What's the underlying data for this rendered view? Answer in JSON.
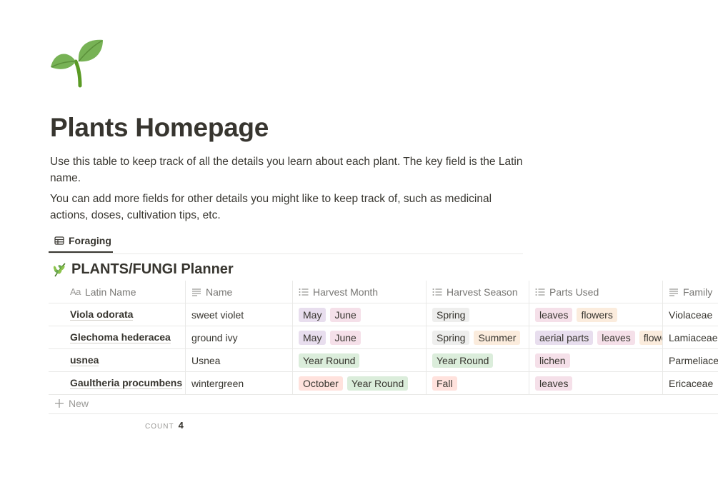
{
  "page": {
    "title": "Plants Homepage",
    "description": [
      "Use this table to keep track of all the details you learn about each plant. The key field is the Latin name.",
      "You can add more fields for other details you might like to keep track of, such as medicinal actions, doses, cultivation tips, etc."
    ],
    "icon": "seedling-icon"
  },
  "views": {
    "active_tab": "Foraging"
  },
  "database": {
    "title": "PLANTS/FUNGI Planner",
    "icon": "herb-icon",
    "columns": [
      "Latin Name",
      "Name",
      "Harvest Month",
      "Harvest Season",
      "Parts Used",
      "Family"
    ],
    "column_icons": [
      "text-aa-icon",
      "text-lines-icon",
      "list-icon",
      "list-icon",
      "list-icon",
      "text-lines-icon"
    ],
    "rows": [
      {
        "latin": "Viola odorata",
        "name": "sweet violet",
        "months": [
          {
            "label": "May",
            "color": "#e8deee"
          },
          {
            "label": "June",
            "color": "#f5e0e9"
          }
        ],
        "seasons": [
          {
            "label": "Spring",
            "color": "#eeeeed"
          }
        ],
        "parts": [
          {
            "label": "leaves",
            "color": "#f5e0e9"
          },
          {
            "label": "flowers",
            "color": "#fbecdd"
          }
        ],
        "family": "Violaceae"
      },
      {
        "latin": "Glechoma hederacea",
        "name": "ground ivy",
        "months": [
          {
            "label": "May",
            "color": "#e8deee"
          },
          {
            "label": "June",
            "color": "#f5e0e9"
          }
        ],
        "seasons": [
          {
            "label": "Spring",
            "color": "#eeeeed"
          },
          {
            "label": "Summer",
            "color": "#fbecdd"
          }
        ],
        "parts": [
          {
            "label": "aerial parts",
            "color": "#e8deee"
          },
          {
            "label": "leaves",
            "color": "#f5e0e9"
          },
          {
            "label": "flowers",
            "color": "#fbecdd"
          }
        ],
        "family": "Lamiaceae"
      },
      {
        "latin": "usnea",
        "name": "Usnea",
        "months": [
          {
            "label": "Year Round",
            "color": "#dbeddb"
          }
        ],
        "seasons": [
          {
            "label": "Year Round",
            "color": "#dbeddb"
          }
        ],
        "parts": [
          {
            "label": "lichen",
            "color": "#f5e0e9"
          }
        ],
        "family": "Parmeliaceae"
      },
      {
        "latin": "Gaultheria procumbens",
        "name": "wintergreen",
        "months": [
          {
            "label": "October",
            "color": "#ffe2dd"
          },
          {
            "label": "Year Round",
            "color": "#dbeddb"
          }
        ],
        "seasons": [
          {
            "label": "Fall",
            "color": "#ffe2dd"
          }
        ],
        "parts": [
          {
            "label": "leaves",
            "color": "#f5e0e9"
          }
        ],
        "family": "Ericaceae"
      }
    ],
    "new_label": "New",
    "count_label": "COUNT",
    "count_value": "4"
  }
}
